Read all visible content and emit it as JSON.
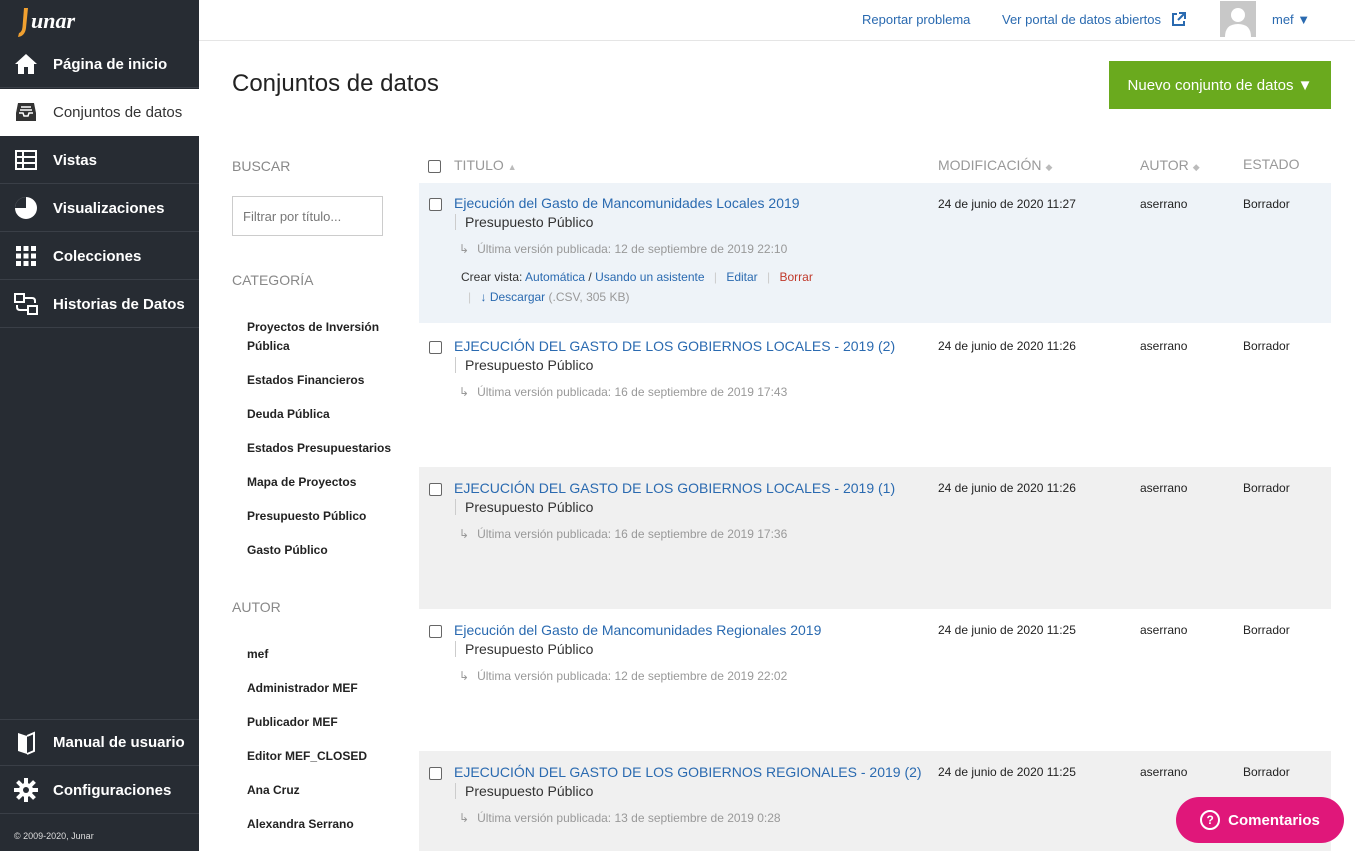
{
  "app": {
    "logo": "junar",
    "copyright": "© 2009-2020, Junar"
  },
  "sidebar": {
    "items": [
      {
        "label": "Página de inicio",
        "icon": "home-icon"
      },
      {
        "label": "Conjuntos de datos",
        "icon": "inbox-tray-icon"
      },
      {
        "label": "Vistas",
        "icon": "table-icon"
      },
      {
        "label": "Visualizaciones",
        "icon": "pie-chart-icon"
      },
      {
        "label": "Colecciones",
        "icon": "grid-icon"
      },
      {
        "label": "Historias de Datos",
        "icon": "story-icon"
      }
    ],
    "bottom_items": [
      {
        "label": "Manual de usuario",
        "icon": "book-icon"
      },
      {
        "label": "Configuraciones",
        "icon": "gear-icon"
      }
    ]
  },
  "topbar": {
    "report_problem": "Reportar problema",
    "open_portal": "Ver portal de datos abiertos",
    "user": "mef ▼"
  },
  "page": {
    "title": "Conjuntos de datos",
    "new_button": "Nuevo conjunto de datos ▼"
  },
  "filters": {
    "search_heading": "BUSCAR",
    "search_placeholder": "Filtrar por título...",
    "category_heading": "CATEGORÍA",
    "categories": [
      "Proyectos de Inversión Pública",
      "Estados Financieros",
      "Deuda Pública",
      "Estados Presupuestarios",
      "Mapa de Proyectos",
      "Presupuesto Público",
      "Gasto Público"
    ],
    "author_heading": "AUTOR",
    "authors": [
      "mef",
      "Administrador MEF",
      "Publicador MEF",
      "Editor MEF_CLOSED",
      "Ana Cruz",
      "Alexandra Serrano"
    ]
  },
  "table": {
    "headers": {
      "title": "TITULO",
      "modified": "MODIFICACIÓN",
      "author": "AUTOR",
      "status": "ESTADO"
    },
    "rows": [
      {
        "title": "Ejecución del Gasto de Mancomunidades Locales 2019",
        "category": "Presupuesto Público",
        "version": "Última versión publicada: 12 de septiembre de 2019 22:10",
        "modified": "24 de junio de 2020 11:27",
        "author": "aserrano",
        "status": "Borrador"
      },
      {
        "title": "EJECUCIÓN DEL GASTO DE LOS GOBIERNOS LOCALES - 2019 (2)",
        "category": "Presupuesto Público",
        "version": "Última versión publicada: 16 de septiembre de 2019 17:43",
        "modified": "24 de junio de 2020 11:26",
        "author": "aserrano",
        "status": "Borrador"
      },
      {
        "title": "EJECUCIÓN DEL GASTO DE LOS GOBIERNOS LOCALES - 2019 (1)",
        "category": "Presupuesto Público",
        "version": "Última versión publicada: 16 de septiembre de 2019 17:36",
        "modified": "24 de junio de 2020 11:26",
        "author": "aserrano",
        "status": "Borrador"
      },
      {
        "title": "Ejecución del Gasto de Mancomunidades Regionales 2019",
        "category": "Presupuesto Público",
        "version": "Última versión publicada: 12 de septiembre de 2019 22:02",
        "modified": "24 de junio de 2020 11:25",
        "author": "aserrano",
        "status": "Borrador"
      },
      {
        "title": "EJECUCIÓN DEL GASTO DE LOS GOBIERNOS REGIONALES - 2019 (2)",
        "category": "Presupuesto Público",
        "version": "Última versión publicada: 13 de septiembre de 2019 0:28",
        "modified": "24 de junio de 2020 11:25",
        "author": "aserrano",
        "status": "Borrador"
      }
    ],
    "row_actions": {
      "create_view": "Crear vista:",
      "automatic": "Automática",
      "slash": "/",
      "wizard": "Usando un asistente",
      "edit": "Editar",
      "delete": "Borrar",
      "download": "Descargar",
      "download_info": "(.CSV, 305 KB)"
    }
  },
  "feedback": {
    "label": "Comentarios"
  },
  "colors": {
    "sidebar_bg": "#272c33",
    "accent_green": "#6aaa1e",
    "link_blue": "#2a6ab0",
    "feedback_pink": "#e0177a"
  }
}
